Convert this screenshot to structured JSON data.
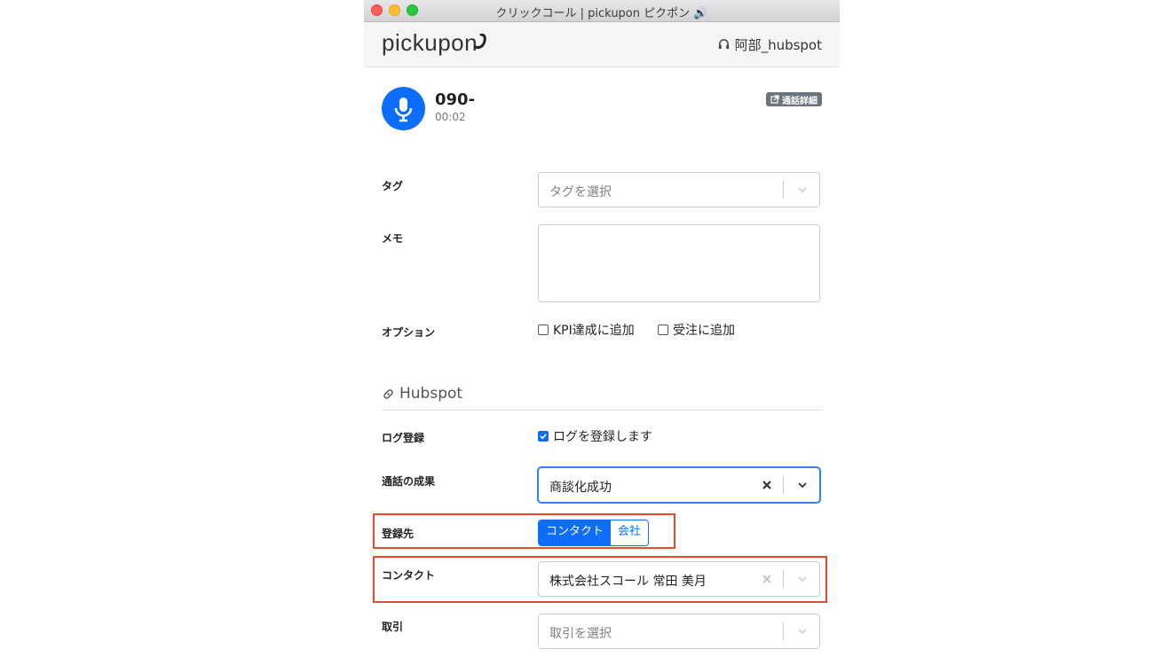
{
  "window": {
    "title": "クリックコール | pickupon ピクポン 🔊"
  },
  "header": {
    "logo": "pickupon",
    "user": "阿部_hubspot"
  },
  "call": {
    "phone": "090-",
    "duration": "00:02",
    "detail_button": "通話詳細"
  },
  "form": {
    "tag_label": "タグ",
    "tag_placeholder": "タグを選択",
    "memo_label": "メモ",
    "options_label": "オプション",
    "option_kpi": "KPI達成に追加",
    "option_order": "受注に追加"
  },
  "hubspot": {
    "section_title": "Hubspot",
    "log_label": "ログ登録",
    "log_checkbox": "ログを登録します",
    "outcome_label": "通話の成果",
    "outcome_value": "商談化成功",
    "destination_label": "登録先",
    "destination_options": [
      "コンタクト",
      "会社"
    ],
    "destination_selected": "コンタクト",
    "contact_label": "コンタクト",
    "contact_value": "株式会社スコール 常田 美月",
    "deal_label": "取引",
    "deal_placeholder": "取引を選択"
  },
  "colors": {
    "accent": "#0d6efd",
    "highlight": "#e84b2c"
  }
}
